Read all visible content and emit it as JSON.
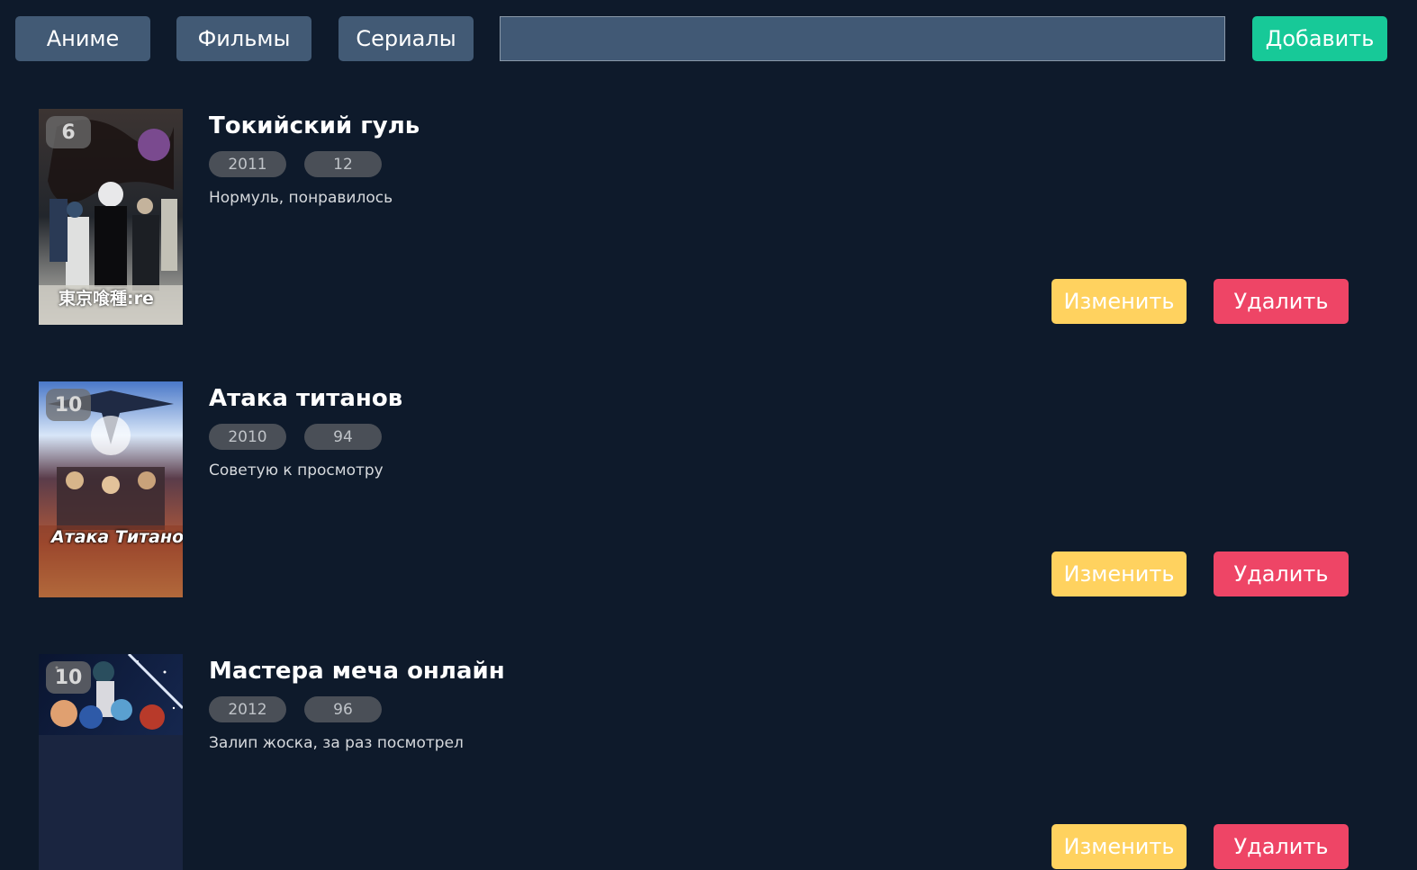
{
  "nav": {
    "anime_label": "Аниме",
    "films_label": "Фильмы",
    "series_label": "Сериалы",
    "search_value": "",
    "search_placeholder": "",
    "add_label": "Добавить"
  },
  "colors": {
    "background": "#0e1a2b",
    "nav_button": "#425a75",
    "add_button": "#17c998",
    "edit_button": "#ffd25f",
    "delete_button": "#ee4566",
    "pill": "#4a4f57"
  },
  "items": [
    {
      "rating": "6",
      "title": "Токийский гуль",
      "year": "2011",
      "episodes": "12",
      "comment": "Нормуль, понравилось",
      "poster_text": "東京喰種:re",
      "edit_label": "Изменить",
      "delete_label": "Удалить"
    },
    {
      "rating": "10",
      "title": "Атака титанов",
      "year": "2010",
      "episodes": "94",
      "comment": "Советую к просмотру",
      "poster_text": "Атака Титанов",
      "edit_label": "Изменить",
      "delete_label": "Удалить"
    },
    {
      "rating": "10",
      "title": "Мастера меча онлайн",
      "year": "2012",
      "episodes": "96",
      "comment": "Залип жоска, за раз посмотрел",
      "poster_text": "",
      "edit_label": "Изменить",
      "delete_label": "Удалить"
    }
  ]
}
